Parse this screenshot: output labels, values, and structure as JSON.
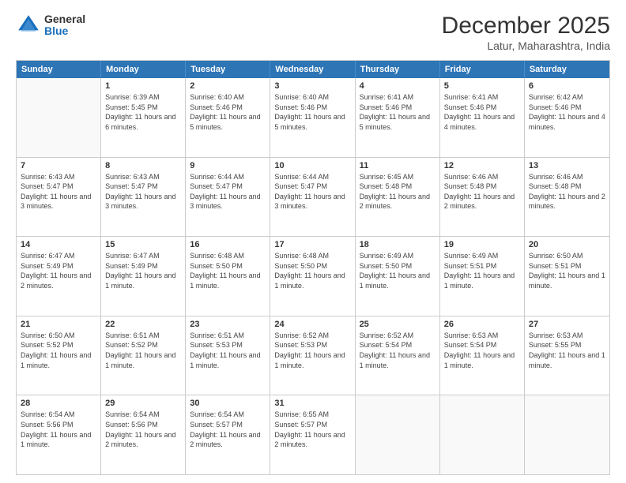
{
  "logo": {
    "general": "General",
    "blue": "Blue"
  },
  "header": {
    "month": "December 2025",
    "location": "Latur, Maharashtra, India"
  },
  "weekdays": [
    "Sunday",
    "Monday",
    "Tuesday",
    "Wednesday",
    "Thursday",
    "Friday",
    "Saturday"
  ],
  "rows": [
    [
      {
        "day": "",
        "sunrise": "",
        "sunset": "",
        "daylight": "",
        "empty": true
      },
      {
        "day": "1",
        "sunrise": "Sunrise: 6:39 AM",
        "sunset": "Sunset: 5:45 PM",
        "daylight": "Daylight: 11 hours and 6 minutes."
      },
      {
        "day": "2",
        "sunrise": "Sunrise: 6:40 AM",
        "sunset": "Sunset: 5:46 PM",
        "daylight": "Daylight: 11 hours and 5 minutes."
      },
      {
        "day": "3",
        "sunrise": "Sunrise: 6:40 AM",
        "sunset": "Sunset: 5:46 PM",
        "daylight": "Daylight: 11 hours and 5 minutes."
      },
      {
        "day": "4",
        "sunrise": "Sunrise: 6:41 AM",
        "sunset": "Sunset: 5:46 PM",
        "daylight": "Daylight: 11 hours and 5 minutes."
      },
      {
        "day": "5",
        "sunrise": "Sunrise: 6:41 AM",
        "sunset": "Sunset: 5:46 PM",
        "daylight": "Daylight: 11 hours and 4 minutes."
      },
      {
        "day": "6",
        "sunrise": "Sunrise: 6:42 AM",
        "sunset": "Sunset: 5:46 PM",
        "daylight": "Daylight: 11 hours and 4 minutes."
      }
    ],
    [
      {
        "day": "7",
        "sunrise": "Sunrise: 6:43 AM",
        "sunset": "Sunset: 5:47 PM",
        "daylight": "Daylight: 11 hours and 3 minutes."
      },
      {
        "day": "8",
        "sunrise": "Sunrise: 6:43 AM",
        "sunset": "Sunset: 5:47 PM",
        "daylight": "Daylight: 11 hours and 3 minutes."
      },
      {
        "day": "9",
        "sunrise": "Sunrise: 6:44 AM",
        "sunset": "Sunset: 5:47 PM",
        "daylight": "Daylight: 11 hours and 3 minutes."
      },
      {
        "day": "10",
        "sunrise": "Sunrise: 6:44 AM",
        "sunset": "Sunset: 5:47 PM",
        "daylight": "Daylight: 11 hours and 3 minutes."
      },
      {
        "day": "11",
        "sunrise": "Sunrise: 6:45 AM",
        "sunset": "Sunset: 5:48 PM",
        "daylight": "Daylight: 11 hours and 2 minutes."
      },
      {
        "day": "12",
        "sunrise": "Sunrise: 6:46 AM",
        "sunset": "Sunset: 5:48 PM",
        "daylight": "Daylight: 11 hours and 2 minutes."
      },
      {
        "day": "13",
        "sunrise": "Sunrise: 6:46 AM",
        "sunset": "Sunset: 5:48 PM",
        "daylight": "Daylight: 11 hours and 2 minutes."
      }
    ],
    [
      {
        "day": "14",
        "sunrise": "Sunrise: 6:47 AM",
        "sunset": "Sunset: 5:49 PM",
        "daylight": "Daylight: 11 hours and 2 minutes."
      },
      {
        "day": "15",
        "sunrise": "Sunrise: 6:47 AM",
        "sunset": "Sunset: 5:49 PM",
        "daylight": "Daylight: 11 hours and 1 minute."
      },
      {
        "day": "16",
        "sunrise": "Sunrise: 6:48 AM",
        "sunset": "Sunset: 5:50 PM",
        "daylight": "Daylight: 11 hours and 1 minute."
      },
      {
        "day": "17",
        "sunrise": "Sunrise: 6:48 AM",
        "sunset": "Sunset: 5:50 PM",
        "daylight": "Daylight: 11 hours and 1 minute."
      },
      {
        "day": "18",
        "sunrise": "Sunrise: 6:49 AM",
        "sunset": "Sunset: 5:50 PM",
        "daylight": "Daylight: 11 hours and 1 minute."
      },
      {
        "day": "19",
        "sunrise": "Sunrise: 6:49 AM",
        "sunset": "Sunset: 5:51 PM",
        "daylight": "Daylight: 11 hours and 1 minute."
      },
      {
        "day": "20",
        "sunrise": "Sunrise: 6:50 AM",
        "sunset": "Sunset: 5:51 PM",
        "daylight": "Daylight: 11 hours and 1 minute."
      }
    ],
    [
      {
        "day": "21",
        "sunrise": "Sunrise: 6:50 AM",
        "sunset": "Sunset: 5:52 PM",
        "daylight": "Daylight: 11 hours and 1 minute."
      },
      {
        "day": "22",
        "sunrise": "Sunrise: 6:51 AM",
        "sunset": "Sunset: 5:52 PM",
        "daylight": "Daylight: 11 hours and 1 minute."
      },
      {
        "day": "23",
        "sunrise": "Sunrise: 6:51 AM",
        "sunset": "Sunset: 5:53 PM",
        "daylight": "Daylight: 11 hours and 1 minute."
      },
      {
        "day": "24",
        "sunrise": "Sunrise: 6:52 AM",
        "sunset": "Sunset: 5:53 PM",
        "daylight": "Daylight: 11 hours and 1 minute."
      },
      {
        "day": "25",
        "sunrise": "Sunrise: 6:52 AM",
        "sunset": "Sunset: 5:54 PM",
        "daylight": "Daylight: 11 hours and 1 minute."
      },
      {
        "day": "26",
        "sunrise": "Sunrise: 6:53 AM",
        "sunset": "Sunset: 5:54 PM",
        "daylight": "Daylight: 11 hours and 1 minute."
      },
      {
        "day": "27",
        "sunrise": "Sunrise: 6:53 AM",
        "sunset": "Sunset: 5:55 PM",
        "daylight": "Daylight: 11 hours and 1 minute."
      }
    ],
    [
      {
        "day": "28",
        "sunrise": "Sunrise: 6:54 AM",
        "sunset": "Sunset: 5:56 PM",
        "daylight": "Daylight: 11 hours and 1 minute."
      },
      {
        "day": "29",
        "sunrise": "Sunrise: 6:54 AM",
        "sunset": "Sunset: 5:56 PM",
        "daylight": "Daylight: 11 hours and 2 minutes."
      },
      {
        "day": "30",
        "sunrise": "Sunrise: 6:54 AM",
        "sunset": "Sunset: 5:57 PM",
        "daylight": "Daylight: 11 hours and 2 minutes."
      },
      {
        "day": "31",
        "sunrise": "Sunrise: 6:55 AM",
        "sunset": "Sunset: 5:57 PM",
        "daylight": "Daylight: 11 hours and 2 minutes."
      },
      {
        "day": "",
        "sunrise": "",
        "sunset": "",
        "daylight": "",
        "empty": true
      },
      {
        "day": "",
        "sunrise": "",
        "sunset": "",
        "daylight": "",
        "empty": true
      },
      {
        "day": "",
        "sunrise": "",
        "sunset": "",
        "daylight": "",
        "empty": true
      }
    ]
  ]
}
